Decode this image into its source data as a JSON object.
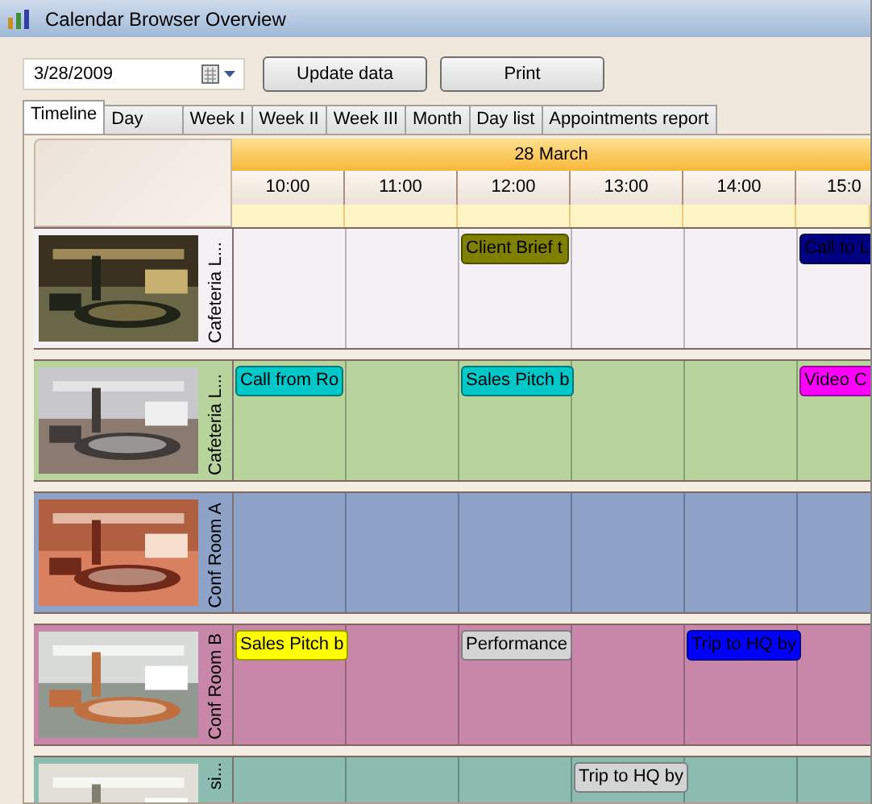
{
  "window": {
    "title": "Calendar Browser Overview"
  },
  "toolbar": {
    "date": "3/28/2009",
    "buttons": [
      "Update data",
      "Print"
    ]
  },
  "tabs": [
    {
      "label": "Timeline",
      "selected": true
    },
    {
      "label": "Day",
      "selected": false
    },
    {
      "label": "Week I",
      "selected": false
    },
    {
      "label": "Week II",
      "selected": false
    },
    {
      "label": "Week III",
      "selected": false
    },
    {
      "label": "Month",
      "selected": false
    },
    {
      "label": "Day list",
      "selected": false
    },
    {
      "label": "Appointments report",
      "selected": false
    }
  ],
  "timeline": {
    "date": "28 March",
    "hours": [
      "10:00",
      "11:00",
      "12:00",
      "13:00",
      "14:00",
      "15:0"
    ],
    "resources": [
      {
        "name": "Cafeteria L...",
        "color": "#f4f0f4",
        "slots": [
          {
            "kind": "empty"
          },
          {
            "kind": "empty"
          },
          {
            "kind": "appointment",
            "title": "Client Brief t",
            "color": "#808000"
          },
          {
            "kind": "empty"
          },
          {
            "kind": "empty"
          },
          {
            "kind": "appointment",
            "title": "Call to L",
            "color": "#000080"
          }
        ]
      },
      {
        "name": "Cafeteria L...",
        "color": "#b8d49c",
        "slots": [
          {
            "kind": "appointment",
            "title": "Call from Ro",
            "color": "#00c8c8"
          },
          {
            "kind": "empty"
          },
          {
            "kind": "appointment",
            "title": "Sales Pitch b",
            "color": "#00c8c8"
          },
          {
            "kind": "empty"
          },
          {
            "kind": "empty"
          },
          {
            "kind": "appointment",
            "title": "Video C",
            "color": "#ff00ff"
          }
        ]
      },
      {
        "name": "Conf Room A",
        "color": "#8ea2c8",
        "slots": [
          {
            "kind": "empty"
          },
          {
            "kind": "empty"
          },
          {
            "kind": "empty"
          },
          {
            "kind": "empty"
          },
          {
            "kind": "empty"
          },
          {
            "kind": "empty"
          }
        ]
      },
      {
        "name": "Conf Room B",
        "color": "#c886a8",
        "slots": [
          {
            "kind": "appointment",
            "title": "Sales Pitch b",
            "color": "#ffff00"
          },
          {
            "kind": "empty"
          },
          {
            "kind": "appointment",
            "title": "Performance",
            "color": "#d4d4d4"
          },
          {
            "kind": "empty"
          },
          {
            "kind": "appointment",
            "title": "Trip to HQ by",
            "color": "#0000ff"
          },
          {
            "kind": "empty"
          }
        ]
      },
      {
        "name": "si...",
        "color": "#8cbcb0",
        "slots": [
          {
            "kind": "empty"
          },
          {
            "kind": "empty"
          },
          {
            "kind": "empty"
          },
          {
            "kind": "appointment",
            "title": "Trip to HQ by",
            "color": "#d4d4d4"
          },
          {
            "kind": "empty"
          },
          {
            "kind": "empty"
          }
        ]
      }
    ]
  }
}
